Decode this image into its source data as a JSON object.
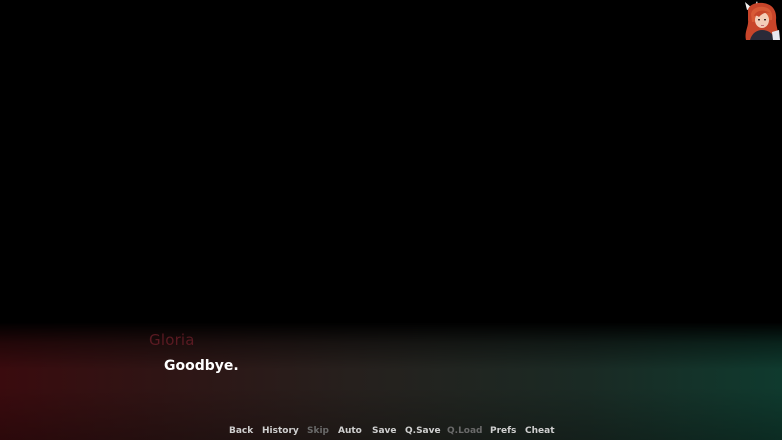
{
  "speaker": {
    "name": "Gloria",
    "name_color": "#5a1a22"
  },
  "dialogue": {
    "text": "Goodbye."
  },
  "quick_menu": {
    "back": "Back",
    "history": "History",
    "skip": "Skip",
    "auto": "Auto",
    "save": "Save",
    "qsave": "Q.Save",
    "qload": "Q.Load",
    "prefs": "Prefs",
    "cheat": "Cheat",
    "disabled_items": [
      "Skip",
      "Q.Load"
    ]
  },
  "colors": {
    "background": "#000000",
    "textbox_left": "#3a0b0e",
    "textbox_right": "#0f3a2e",
    "dialogue_text": "#ffffff",
    "menu_text": "#cfcfcf",
    "menu_disabled": "#6a6a6a"
  },
  "portrait": {
    "icon": "character-portrait-icon"
  }
}
